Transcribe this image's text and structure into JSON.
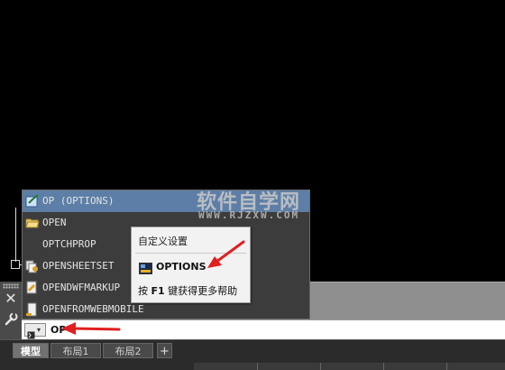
{
  "watermark": {
    "main": "软件自学网",
    "url": "WWW.RJZXW.COM"
  },
  "autocomplete": {
    "items": [
      {
        "label": "OP (OPTIONS)",
        "icon": "options-icon",
        "selected": true
      },
      {
        "label": "OPEN",
        "icon": "folder-open-icon",
        "selected": false
      },
      {
        "label": "OPTCHPROP",
        "icon": "",
        "selected": false
      },
      {
        "label": "OPENSHEETSET",
        "icon": "sheetset-icon",
        "selected": false
      },
      {
        "label": "OPENDWFMARKUP",
        "icon": "markup-icon",
        "selected": false
      },
      {
        "label": "OPENFROMWEBMOBILE",
        "icon": "web-mobile-icon",
        "selected": false
      }
    ]
  },
  "tooltip": {
    "title": "自定义设置",
    "command": "OPTIONS",
    "help_prefix": "按 ",
    "help_key": "F1",
    "help_suffix": " 键获得更多帮助"
  },
  "command_line": {
    "value": "OP"
  },
  "tabs": [
    {
      "label": "模型",
      "active": true
    },
    {
      "label": "布局1",
      "active": false
    },
    {
      "label": "布局2",
      "active": false
    }
  ],
  "tab_add_label": "+",
  "colors": {
    "selection": "#5d7ea6",
    "arrow": "#e02020",
    "canvas": "#000000"
  }
}
